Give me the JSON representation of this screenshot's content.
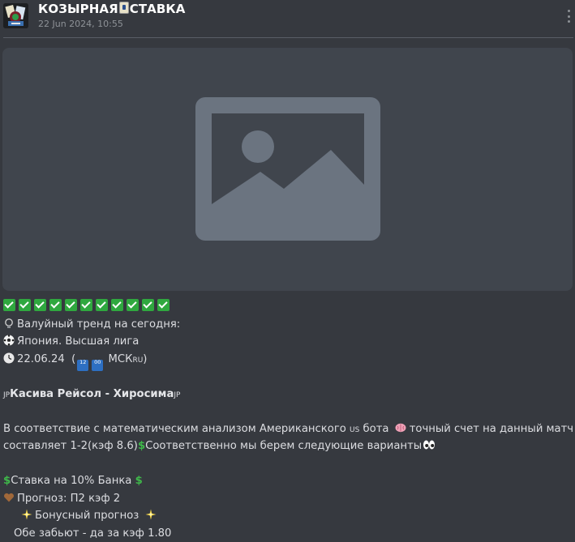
{
  "header": {
    "channel_name_part1": "КОЗЫРНАЯ",
    "channel_name_part2": "СТАВКА",
    "date": "22 Jun 2024, 10:55",
    "icon": "joker-card-icon",
    "menu_icon": "more-vertical-icon"
  },
  "image": {
    "icon": "image-placeholder-icon"
  },
  "post": {
    "checks_count": 11,
    "trend_icon": "lightbulb-icon",
    "trend": "Валуйный тренд на сегодня:",
    "league_icon": "soccer-ball-icon",
    "league": "Япония. Высшая лига",
    "date_icon": "clock-icon",
    "date_value": "22.06.24",
    "date_open": "(",
    "time_digits_1": "12",
    "time_digits_2": "00",
    "time_suffix": "МСК",
    "ru_flag": "RU",
    "match_flag_left": "JP",
    "match": "Касива Рейсол - Хиросима",
    "match_flag_right": "JP",
    "analysis_1": "В соответствие с математическим анализом Американского",
    "us_flag": "US",
    "analysis_1b": "бота",
    "brain_icon": "brain-icon",
    "analysis_1c": "точный счет на данный матч",
    "analysis_2": "составляет 1-2(кэф 8.6)",
    "analysis_2b": "Соответственно мы берем следующие варианты",
    "eyes_icon": "eyes-icon",
    "bet": "Ставка на 10% Банка",
    "dollar_icon": "dollar-sign-icon",
    "heart_icon": "brown-heart-icon",
    "forecast": "Прогноз: П2 кэф 2",
    "sparkle_icon": "sparkle-icon",
    "bonus": "Бонусный прогноз",
    "both_score": "Обе забьют - да за кэф 1.80"
  },
  "colors": {
    "background": "#36393f",
    "image_placeholder": "#40454d",
    "check_green": "#2fa83f",
    "dollar_green": "#3fb84a"
  }
}
